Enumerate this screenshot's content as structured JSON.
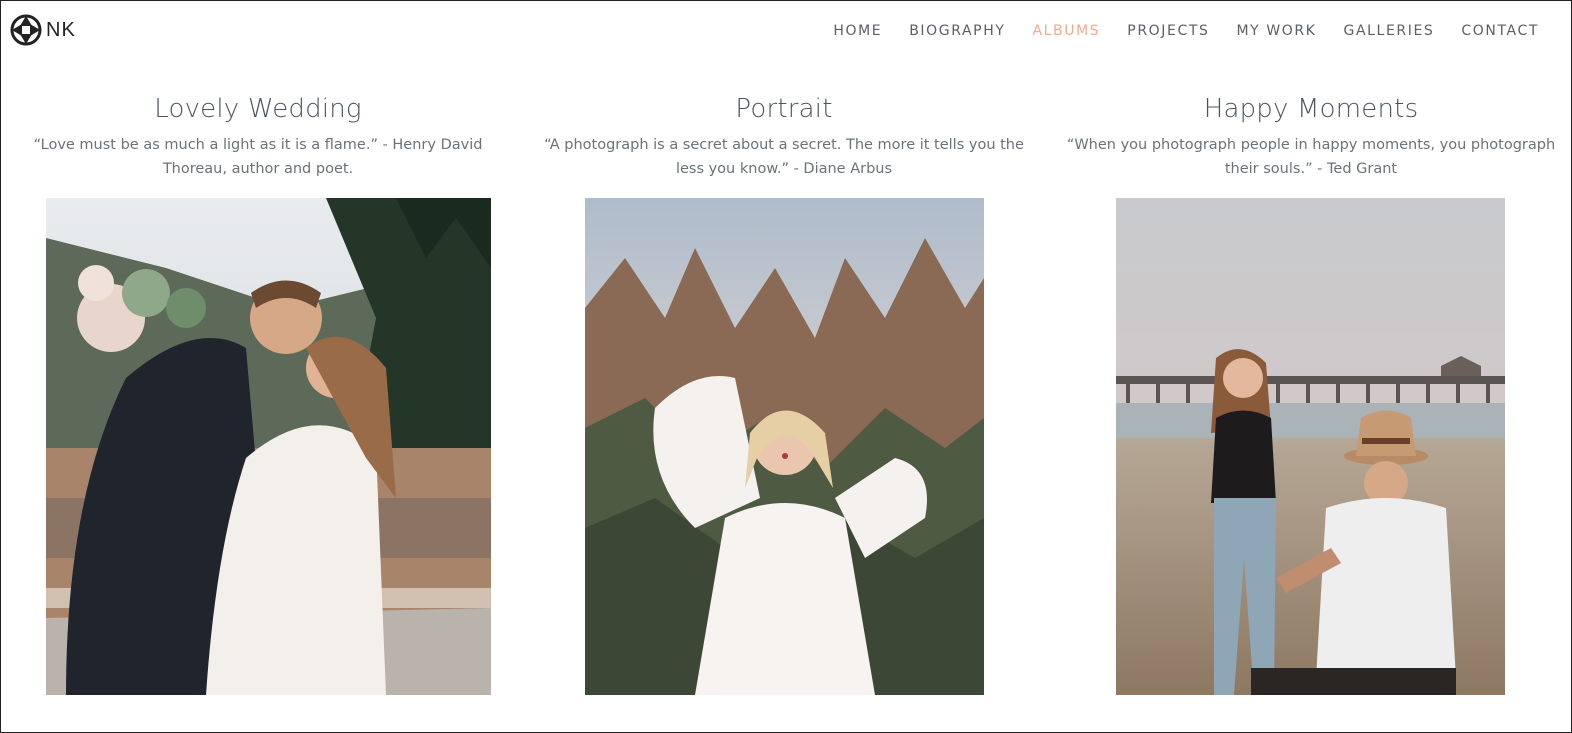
{
  "brand": {
    "logo_text": "NK",
    "logo_icon": "aperture-icon"
  },
  "nav": {
    "items": [
      {
        "label": "HOME"
      },
      {
        "label": "BIOGRAPHY"
      },
      {
        "label": "ALBUMS",
        "active": true
      },
      {
        "label": "PROJECTS"
      },
      {
        "label": "MY WORK"
      },
      {
        "label": "GALLERIES"
      },
      {
        "label": "CONTACT"
      }
    ],
    "active_color": "#f3a98b"
  },
  "albums": [
    {
      "title": "Lovely Wedding",
      "quote_line1": "“Love must be as much a light as it is a flame.” - Henry David",
      "quote_line2": "Thoreau, author and poet."
    },
    {
      "title": "Portrait",
      "quote_line1": "“A photograph is a secret about a secret. The more it tells you the",
      "quote_line2": "less you know.” - Diane Arbus"
    },
    {
      "title": "Happy Moments",
      "quote_line1": "“When you photograph people in happy moments, you photograph",
      "quote_line2": "their souls.” - Ted Grant"
    }
  ]
}
